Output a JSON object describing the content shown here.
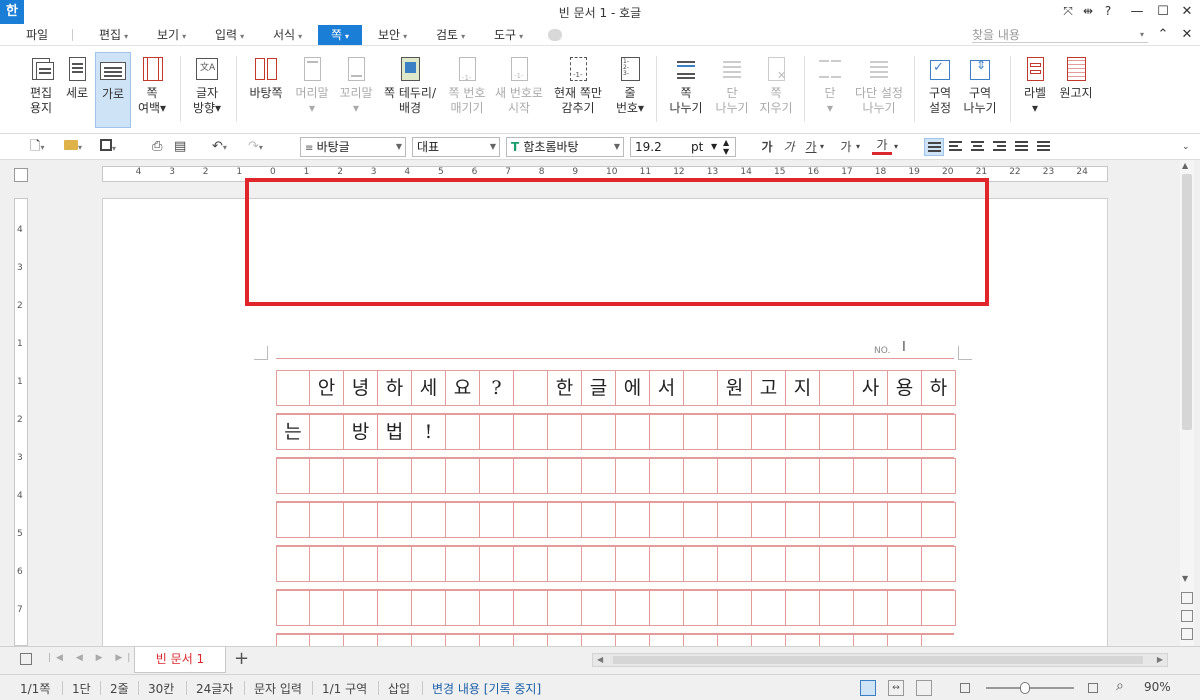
{
  "title_bar": {
    "app_icon": "한",
    "title": "빈 문서 1 - 호글",
    "tools": [
      "⤧",
      "⇹",
      "?"
    ],
    "minimize": "—",
    "maximize": "☐",
    "close": "✕"
  },
  "menu": {
    "items": [
      {
        "label": "파일",
        "arrow": ""
      },
      {
        "label": "편집",
        "arrow": "▾"
      },
      {
        "label": "보기",
        "arrow": "▾"
      },
      {
        "label": "입력",
        "arrow": "▾"
      },
      {
        "label": "서식",
        "arrow": "▾"
      },
      {
        "label": "쪽",
        "arrow": "▾"
      },
      {
        "label": "보안",
        "arrow": "▾"
      },
      {
        "label": "검토",
        "arrow": "▾"
      },
      {
        "label": "도구",
        "arrow": "▾"
      }
    ],
    "active_index": 5,
    "find_placeholder": "찾을 내용",
    "collapse": "⌃",
    "close": "✕"
  },
  "ribbon": {
    "buttons": [
      {
        "l1": "편집",
        "l2": "용지",
        "icon": "paper-edit-icon",
        "disabled": false,
        "selected": false
      },
      {
        "l1": "세로",
        "l2": "",
        "icon": "portrait-icon",
        "disabled": false,
        "selected": false
      },
      {
        "l1": "가로",
        "l2": "",
        "icon": "landscape-icon",
        "disabled": false,
        "selected": true
      },
      {
        "l1": "쪽",
        "l2": "여백▾",
        "icon": "page-margin-icon",
        "disabled": false,
        "selected": false
      },
      {
        "l1": "글자",
        "l2": "방향▾",
        "icon": "text-direction-icon",
        "disabled": false,
        "selected": false
      },
      {
        "l1": "바탕쪽",
        "l2": "",
        "icon": "master-page-icon",
        "disabled": false,
        "selected": false
      },
      {
        "l1": "머리말",
        "l2": "▾",
        "icon": "header-icon",
        "disabled": true,
        "selected": false
      },
      {
        "l1": "꼬리말",
        "l2": "▾",
        "icon": "footer-icon",
        "disabled": true,
        "selected": false
      },
      {
        "l1": "쪽 테두리/",
        "l2": "배경",
        "icon": "page-border-icon",
        "disabled": false,
        "selected": false
      },
      {
        "l1": "쪽 번호",
        "l2": "매기기",
        "icon": "page-number-icon",
        "disabled": true,
        "selected": false
      },
      {
        "l1": "새 번호로",
        "l2": "시작",
        "icon": "new-number-icon",
        "disabled": true,
        "selected": false
      },
      {
        "l1": "현재 쪽만",
        "l2": "감추기",
        "icon": "hide-page-icon",
        "disabled": false,
        "selected": false
      },
      {
        "l1": "줄",
        "l2": "번호▾",
        "icon": "line-number-icon",
        "disabled": false,
        "selected": false
      },
      {
        "l1": "쪽",
        "l2": "나누기",
        "icon": "page-break-icon",
        "disabled": false,
        "selected": false
      },
      {
        "l1": "단",
        "l2": "나누기",
        "icon": "column-break-icon",
        "disabled": true,
        "selected": false
      },
      {
        "l1": "쪽",
        "l2": "지우기",
        "icon": "delete-page-icon",
        "disabled": true,
        "selected": false
      },
      {
        "l1": "단",
        "l2": "▾",
        "icon": "columns-icon",
        "disabled": true,
        "selected": false
      },
      {
        "l1": "다단 설정",
        "l2": "나누기",
        "icon": "multi-column-icon",
        "disabled": true,
        "selected": false
      },
      {
        "l1": "구역",
        "l2": "설정",
        "icon": "section-setup-icon",
        "disabled": false,
        "selected": false
      },
      {
        "l1": "구역",
        "l2": "나누기",
        "icon": "section-break-icon",
        "disabled": false,
        "selected": false
      },
      {
        "l1": "라벨",
        "l2": "▾",
        "icon": "label-icon",
        "disabled": false,
        "selected": false
      },
      {
        "l1": "원고지",
        "l2": "",
        "icon": "manuscript-icon",
        "disabled": false,
        "selected": false
      }
    ]
  },
  "toolbar": {
    "style_value": "바탕글",
    "font_lang": "대표",
    "font_name": "함초롬바탕",
    "font_size": "19.2",
    "font_unit": "pt",
    "format_buttons": [
      "가",
      "가",
      "가",
      "가",
      "가"
    ]
  },
  "ruler": {
    "h_labels": [
      "4",
      "3",
      "2",
      "1",
      "0",
      "1",
      "2",
      "3",
      "4",
      "5",
      "6",
      "7",
      "8",
      "9",
      "10",
      "11",
      "12",
      "13",
      "14",
      "15",
      "16",
      "17",
      "18",
      "19",
      "20",
      "21",
      "22",
      "23",
      "24"
    ],
    "v_labels": [
      "4",
      "3",
      "2",
      "1",
      "1",
      "2",
      "3",
      "4",
      "5",
      "6",
      "7"
    ]
  },
  "manuscript": {
    "no_label": "NO.",
    "row1": [
      "",
      "안",
      "녕",
      "하",
      "세",
      "요",
      "?",
      "",
      "한",
      "글",
      "에",
      "서",
      "",
      "원",
      "고",
      "지",
      "",
      "사",
      "용",
      "하"
    ],
    "row2": [
      "는",
      "",
      "방",
      "법",
      "!",
      "",
      "",
      "",
      "",
      "",
      "",
      "",
      "",
      "",
      "",
      "",
      "",
      "",
      "",
      ""
    ]
  },
  "tabs": {
    "doc_tab": "빈 문서 1",
    "add": "+"
  },
  "status": {
    "page": "1/1쪽",
    "column": "1단",
    "line": "2줄",
    "col": "30칸",
    "chars": "24글자",
    "input_mode": "문자 입력",
    "section": "1/1 구역",
    "insert": "삽입",
    "track": "변경 내용 [기록 중지]",
    "zoom": "90%",
    "zoom_value": 90
  },
  "colors": {
    "accent": "#1b7ed6",
    "grid": "#e39b9b",
    "highlight": "#e0262b",
    "tab_text": "#d9272d"
  }
}
